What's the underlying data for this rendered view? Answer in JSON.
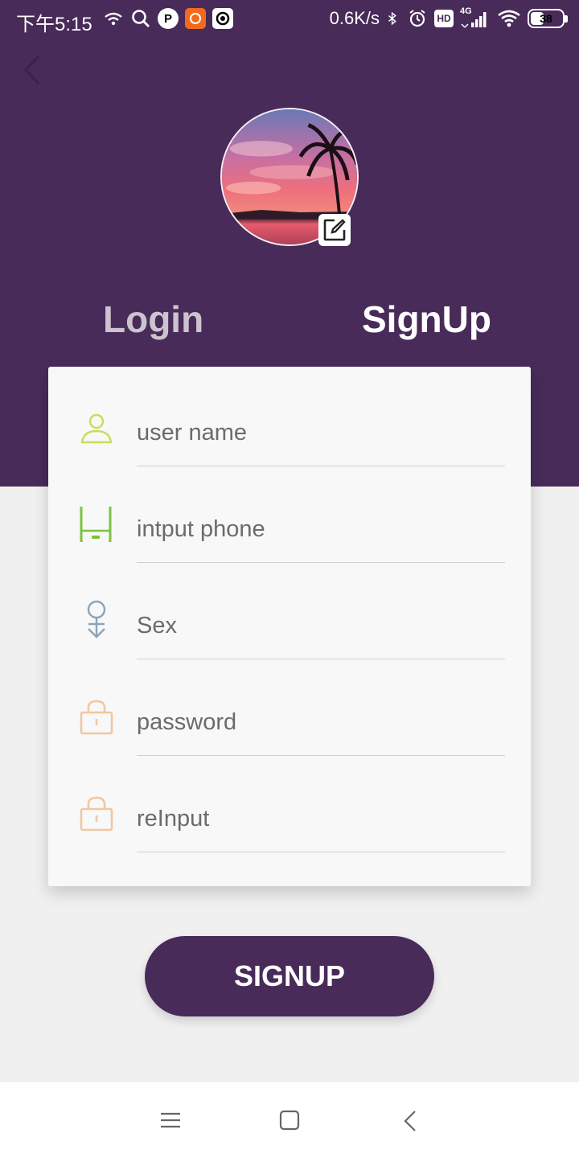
{
  "status_bar": {
    "time": "下午5:15",
    "net_speed": "0.6K/s",
    "battery_level": "38",
    "network_type": "4G",
    "hd_badge": "HD"
  },
  "header": {
    "back_icon": "chevron-left-icon",
    "avatar_image": "sunset-palm-tree-avatar",
    "edit_icon": "edit-icon"
  },
  "tabs": {
    "login": "Login",
    "signup": "SignUp",
    "active": "signup"
  },
  "form": {
    "fields": [
      {
        "icon": "user-icon",
        "placeholder": "user name",
        "value": ""
      },
      {
        "icon": "phone-icon",
        "placeholder": "intput phone",
        "value": ""
      },
      {
        "icon": "sex-icon",
        "placeholder": "Sex",
        "value": ""
      },
      {
        "icon": "lock-icon",
        "placeholder": "password",
        "value": ""
      },
      {
        "icon": "lock-icon",
        "placeholder": "reInput",
        "value": ""
      }
    ]
  },
  "signup_button": {
    "label": "SIGNUP"
  },
  "nav_bar": {
    "items": [
      "menu-icon",
      "home-square-icon",
      "back-triangle-icon"
    ]
  },
  "colors": {
    "header_bg": "#482b59",
    "page_bg": "#f1f0f1",
    "card_bg": "#f8f8f8",
    "user_icon": "#c8dc5a",
    "phone_icon": "#7cc243",
    "sex_icon": "#8aa3bb",
    "lock_icon": "#f0c7a2"
  }
}
